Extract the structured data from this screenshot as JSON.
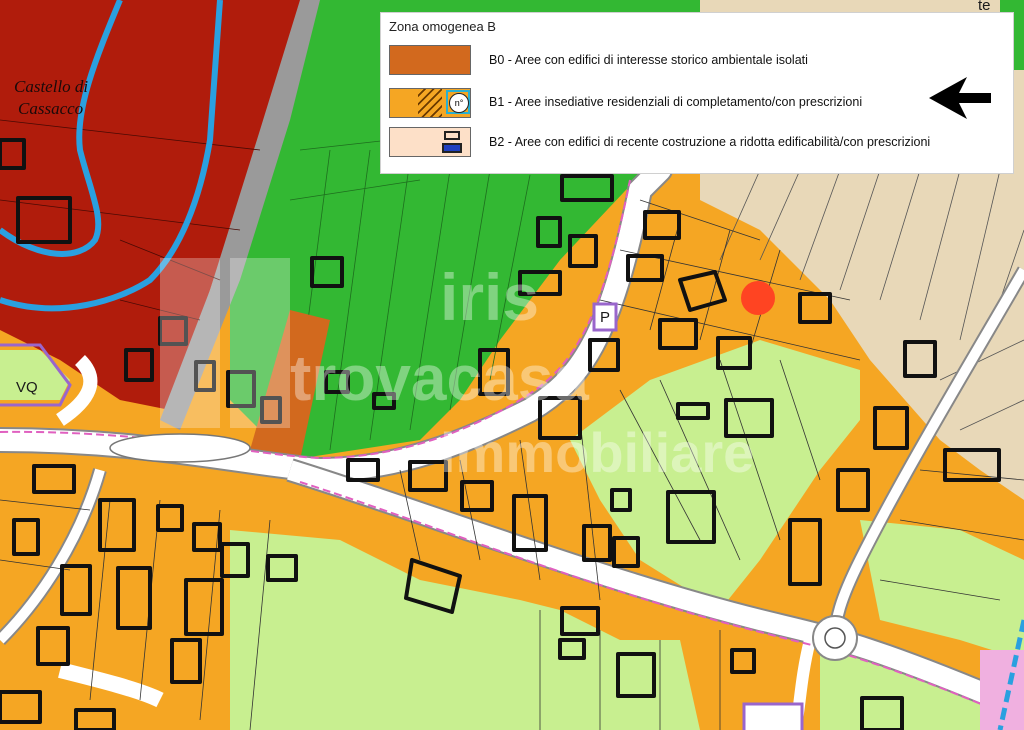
{
  "map": {
    "place_label_line1": "Castello di",
    "place_label_line2": "Cassacco",
    "zone_label": "VQ",
    "parking_label": "P",
    "corner_label": "te"
  },
  "legend": {
    "title": "Zona omogenea B",
    "items": [
      {
        "code": "B0",
        "text": "B0 - Aree con edifici di interesse storico ambientale isolati",
        "color": "#d2691e"
      },
      {
        "code": "B1",
        "text": "B1 - Aree insediative residenziali di completamento/con prescrizioni",
        "color": "#f5a623",
        "badge": "n°"
      },
      {
        "code": "B2",
        "text": "B2 - Aree con edifici di recente costruzione a ridotta edificabilità/con prescrizioni",
        "color": "#fde0c8"
      }
    ]
  },
  "watermark": {
    "line1": "trovacasa",
    "line2": "immobiliare",
    "brand": "iris"
  },
  "colors": {
    "historic": "#b01c0c",
    "green": "#33b833",
    "light_green": "#c8ef90",
    "orange": "#f5a623",
    "beige": "#e8d8b8",
    "road": "#ffffff",
    "water": "#2aa0e0",
    "marker": "#ff4422"
  }
}
